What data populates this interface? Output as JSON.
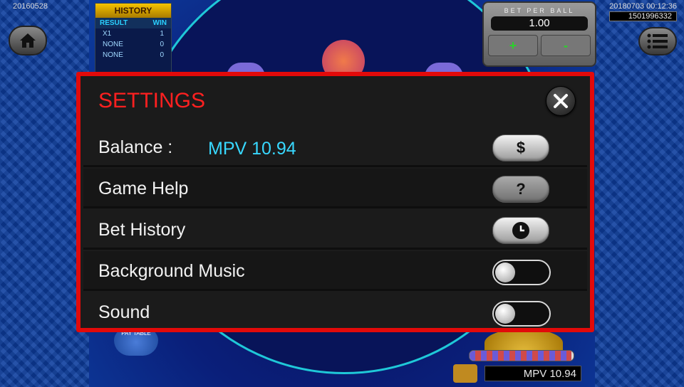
{
  "header": {
    "left_code": "20160528",
    "right_datetime": "20180703 00:12:36",
    "right_id": "1501996332"
  },
  "history": {
    "title": "HISTORY",
    "col_result": "RESULT",
    "col_win": "WIN",
    "rows": [
      {
        "result": "X1",
        "win": "1"
      },
      {
        "result": "NONE",
        "win": "0"
      },
      {
        "result": "NONE",
        "win": "0"
      }
    ]
  },
  "bet": {
    "label": "BET PER BALL",
    "value": "1.00",
    "plus": "+",
    "minus": "-"
  },
  "pay_table_label": "PAY TABLE",
  "footer": {
    "balance": "MPV 10.94",
    "progress_fraction": 0.98
  },
  "settings": {
    "title": "SETTINGS",
    "balance_label": "Balance :",
    "balance_value": "MPV 10.94",
    "balance_button": "$",
    "help_label": "Game Help",
    "help_button": "?",
    "history_label": "Bet History",
    "music_label": "Background Music",
    "music_on": false,
    "sound_label": "Sound",
    "sound_on": false
  },
  "colors": {
    "dialog_border": "#e20a0a",
    "title": "#ff2020",
    "balance_value": "#38d8ff"
  }
}
